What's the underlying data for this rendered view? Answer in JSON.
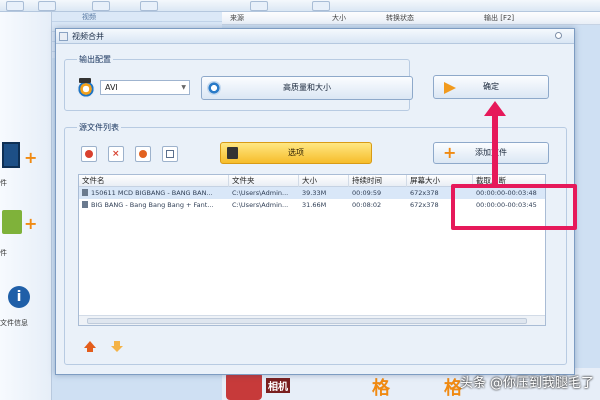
{
  "background": {
    "list_rows": [
      "视频",
      "",
      "",
      ""
    ],
    "columns": [
      "来源",
      "大小",
      "转换状态",
      "输出 [F2]"
    ],
    "sidebar_labels": [
      "件",
      "件",
      "文件信息"
    ],
    "bottom_label": "相机",
    "bottom_chars": [
      "格",
      "格"
    ]
  },
  "dialog": {
    "title": "视频合并",
    "output_group": {
      "label": "输出配置",
      "format": "AVI",
      "quality_button": "高质量和大小",
      "ok_button": "确定"
    },
    "source_group": {
      "label": "源文件列表",
      "options_button": "选项",
      "add_button": "添加文件",
      "columns": [
        "文件名",
        "文件夹",
        "大小",
        "持续时间",
        "屏幕大小",
        "截取片断"
      ],
      "rows": [
        {
          "name": "150611 MCD BIGBANG - BANG BAN...",
          "folder": "C:\\Users\\Admin...",
          "size": "39.33M",
          "duration": "00:09:59",
          "screen": "672x378",
          "clip": "00:00:00-00:03:48"
        },
        {
          "name": "BIG BANG - Bang Bang Bang + Fant...",
          "folder": "C:\\Users\\Admin...",
          "size": "31.66M",
          "duration": "00:08:02",
          "screen": "672x378",
          "clip": "00:00:00-00:03:45"
        }
      ]
    }
  },
  "watermark": "头条 @你压到我腿毛了",
  "colors": {
    "highlight": "#e6195a",
    "accent": "#f08a12"
  }
}
